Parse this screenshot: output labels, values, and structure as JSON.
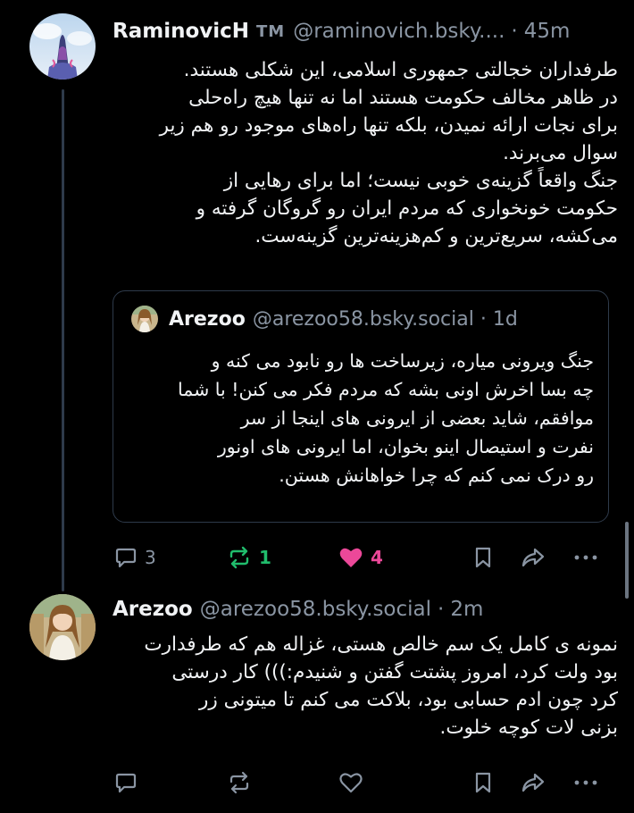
{
  "colors": {
    "background": "#000000",
    "text": "#f1f3f5",
    "muted": "#8a95a3",
    "repost_green": "#20bc6c",
    "like_pink": "#ec4899"
  },
  "post1": {
    "display_name": "RaminovicH",
    "badge": "TM",
    "handle": "@raminovich.bsky....",
    "separator": "·",
    "time": "45m",
    "lines": [
      "طرفداران خجالتی جمهوری اسلامی، این شکلی هستند.",
      "در ظاهر مخالف حکومت هستند اما نه تنها هیچ راه‌حلی",
      "برای نجات ارائه نمیدن، بلکه تنها راه‌های موجود رو هم زیر",
      "سوال می‌برند.",
      "جنگ واقعاً گزینه‌ی خوبی نیست؛ اما برای رهایی از",
      "حکومت خونخواری که مردم ایران رو گروگان گرفته و",
      "می‌کشه، سریع‌ترین و کم‌هزینه‌ترین گزینه‌ست."
    ],
    "quote": {
      "display_name": "Arezoo",
      "handle": "@arezoo58.bsky.social",
      "separator": "·",
      "time": "1d",
      "lines": [
        "جنگ ویرونی میاره، زیرساخت ها رو نابود می کنه و",
        "چه بسا اخرش اونی بشه که مردم فکر می کنن! با شما",
        "موافقم، شاید بعضی از ایرونی های اینجا از سر",
        "نفرت و استیصال اینو بخوان، اما ایرونی های اونور",
        "رو درک نمی کنم که چرا خواهانش هستن."
      ]
    },
    "actions": {
      "reply_count": "3",
      "repost_count": "1",
      "like_count": "4"
    }
  },
  "post2": {
    "display_name": "Arezoo",
    "handle": "@arezoo58.bsky.social",
    "separator": "·",
    "time": "2m",
    "lines": [
      "نمونه ی کامل یک سم خالص هستی، غزاله هم که طرفدارت",
      "بود ولت کرد، امروز پشتت گفتن و شنیدم:))) کار درستی",
      "کرد چون ادم حسابی بود، بلاکت می کنم تا میتونی زر",
      "بزنی لات کوچه خلوت."
    ]
  }
}
